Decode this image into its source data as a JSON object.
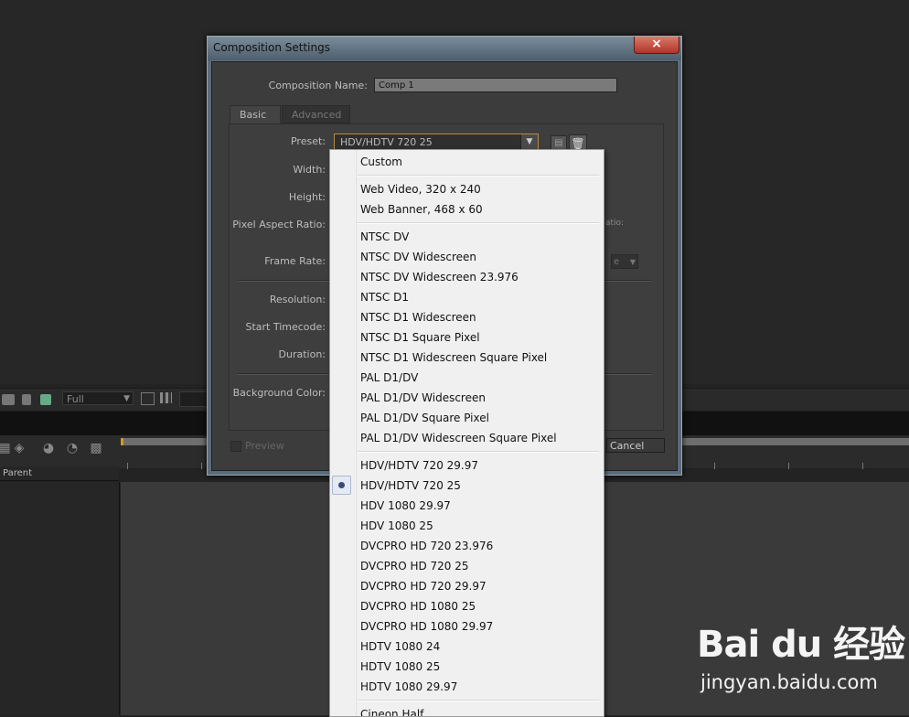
{
  "dialog": {
    "title": "Composition Settings",
    "close_icon": "×",
    "composition_name_label": "Composition Name:",
    "composition_name_value": "Comp 1",
    "tabs": [
      {
        "label": "Basic"
      },
      {
        "label": "Advanced"
      }
    ],
    "preset_label": "Preset:",
    "preset_value": "HDV/HDTV 720 25",
    "width_label": "Width:",
    "height_label": "Height:",
    "pixel_aspect_ratio_label": "Pixel Aspect Ratio:",
    "frame_aspect_fragment": "atio:",
    "frame_rate_label": "Frame Rate:",
    "frame_rate_fragment": "e",
    "resolution_label": "Resolution:",
    "start_timecode_label": "Start Timecode:",
    "duration_label": "Duration:",
    "background_color_label": "Background Color:",
    "preview_label": "Preview",
    "cancel_label": "Cancel"
  },
  "preset_menu": {
    "selected": "HDV/HDTV 720 25",
    "groups": [
      [
        "Custom"
      ],
      [
        "Web Video, 320 x 240",
        "Web Banner, 468 x 60"
      ],
      [
        "NTSC DV",
        "NTSC DV Widescreen",
        "NTSC DV Widescreen 23.976",
        "NTSC D1",
        "NTSC D1 Widescreen",
        "NTSC D1 Square Pixel",
        "NTSC D1 Widescreen Square Pixel",
        "PAL D1/DV",
        "PAL D1/DV Widescreen",
        "PAL D1/DV Square Pixel",
        "PAL D1/DV Widescreen Square Pixel"
      ],
      [
        "HDV/HDTV 720 29.97",
        "HDV/HDTV 720 25",
        "HDV 1080 29.97",
        "HDV 1080 25",
        "DVCPRO HD 720 23.976",
        "DVCPRO HD 720 25",
        "DVCPRO HD 720 29.97",
        "DVCPRO HD 1080 25",
        "DVCPRO HD 1080 29.97",
        "HDTV 1080 24",
        "HDTV 1080 25",
        "HDTV 1080 29.97"
      ],
      [
        "Cineon Half"
      ]
    ]
  },
  "background": {
    "resolution_value": "Full",
    "parent_column": "Parent"
  },
  "watermark": {
    "logo": "Bai du 经验",
    "url": "jingyan.baidu.com"
  }
}
